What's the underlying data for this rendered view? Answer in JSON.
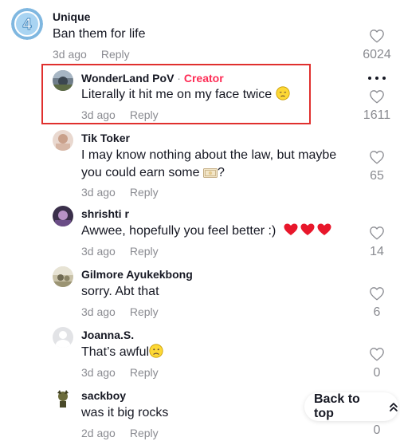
{
  "comments": [
    {
      "username": "Unique",
      "text": "Ban them for life",
      "date": "3d ago",
      "reply": "Reply",
      "likes": "6024"
    },
    {
      "username": "WonderLand PoV",
      "separator": " · ",
      "badge": "Creator",
      "text": "Literally it hit me on my face twice",
      "date": "3d ago",
      "reply": "Reply",
      "likes": "1611"
    },
    {
      "username": "Tik Toker",
      "text_line1": "I may know nothing about the law, but maybe",
      "text_line2": "you could earn some",
      "text_line2_suffix": "?",
      "date": "3d ago",
      "reply": "Reply",
      "likes": "65"
    },
    {
      "username": "shrishti r",
      "text": "Awwee, hopefully you feel better :)",
      "date": "3d ago",
      "reply": "Reply",
      "likes": "14"
    },
    {
      "username": "Gilmore Ayukekbong",
      "text": "sorry. Abt that",
      "date": "3d ago",
      "reply": "Reply",
      "likes": "6"
    },
    {
      "username": "Joanna.S.",
      "text": "That’s awful",
      "date": "3d ago",
      "reply": "Reply",
      "likes": "0"
    },
    {
      "username": "sackboy",
      "text": "was it big rocks",
      "date": "2d ago",
      "reply": "Reply",
      "likes": "0"
    }
  ],
  "back_to_top": "Back to top",
  "colors": {
    "creator": "#fe2c55",
    "muted": "#8a8b91",
    "highlight_border": "#e0302e",
    "heart_red": "#e8172b"
  },
  "icons": {
    "like": "heart-outline-icon",
    "more": "more-dots-icon",
    "back_to_top": "double-chevron-up-icon"
  }
}
